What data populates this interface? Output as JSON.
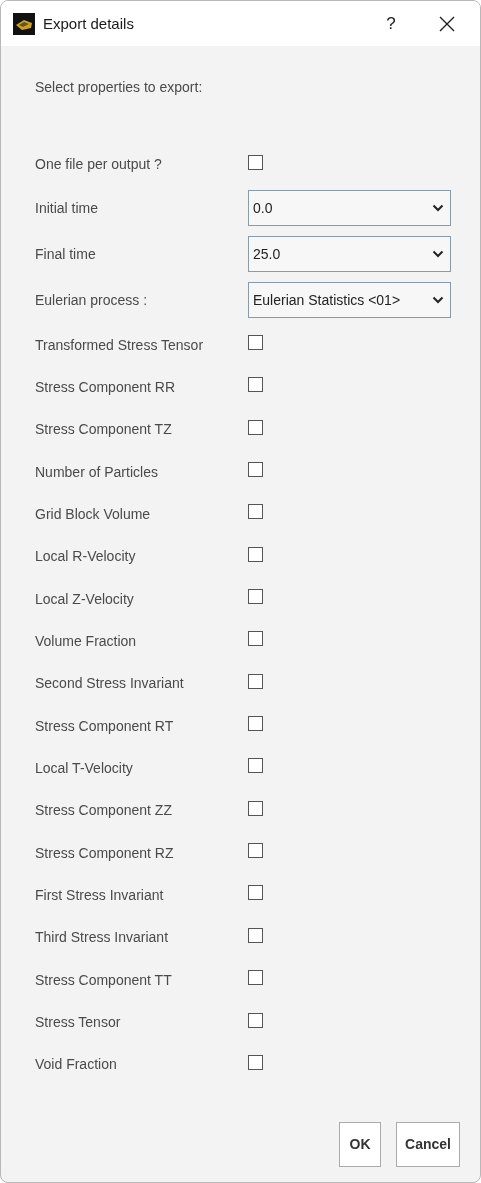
{
  "window": {
    "title": "Export details",
    "help": "?"
  },
  "heading": "Select properties to export:",
  "rows": [
    {
      "kind": "checkbox",
      "label": "One file per output ?",
      "checked": false
    },
    {
      "kind": "dropdown",
      "label": "Initial time",
      "value": "0.0"
    },
    {
      "kind": "dropdown",
      "label": "Final time",
      "value": "25.0"
    },
    {
      "kind": "dropdown",
      "label": "Eulerian process :",
      "value": "Eulerian Statistics <01>"
    },
    {
      "kind": "checkbox",
      "label": "Transformed Stress Tensor",
      "checked": false
    },
    {
      "kind": "checkbox",
      "label": "Stress Component RR",
      "checked": false
    },
    {
      "kind": "checkbox",
      "label": "Stress Component TZ",
      "checked": false
    },
    {
      "kind": "checkbox",
      "label": "Number of Particles",
      "checked": false
    },
    {
      "kind": "checkbox",
      "label": "Grid Block Volume",
      "checked": false
    },
    {
      "kind": "checkbox",
      "label": "Local R-Velocity",
      "checked": false
    },
    {
      "kind": "checkbox",
      "label": "Local Z-Velocity",
      "checked": false
    },
    {
      "kind": "checkbox",
      "label": "Volume Fraction",
      "checked": false
    },
    {
      "kind": "checkbox",
      "label": "Second Stress Invariant",
      "checked": false
    },
    {
      "kind": "checkbox",
      "label": "Stress Component RT",
      "checked": false
    },
    {
      "kind": "checkbox",
      "label": "Local T-Velocity",
      "checked": false
    },
    {
      "kind": "checkbox",
      "label": "Stress Component ZZ",
      "checked": false
    },
    {
      "kind": "checkbox",
      "label": "Stress Component RZ",
      "checked": false
    },
    {
      "kind": "checkbox",
      "label": "First Stress Invariant",
      "checked": false
    },
    {
      "kind": "checkbox",
      "label": "Third Stress Invariant",
      "checked": false
    },
    {
      "kind": "checkbox",
      "label": "Stress Component TT",
      "checked": false
    },
    {
      "kind": "checkbox",
      "label": "Stress Tensor",
      "checked": false
    },
    {
      "kind": "checkbox",
      "label": "Void Fraction",
      "checked": false
    }
  ],
  "buttons": [
    "OK",
    "Cancel"
  ]
}
